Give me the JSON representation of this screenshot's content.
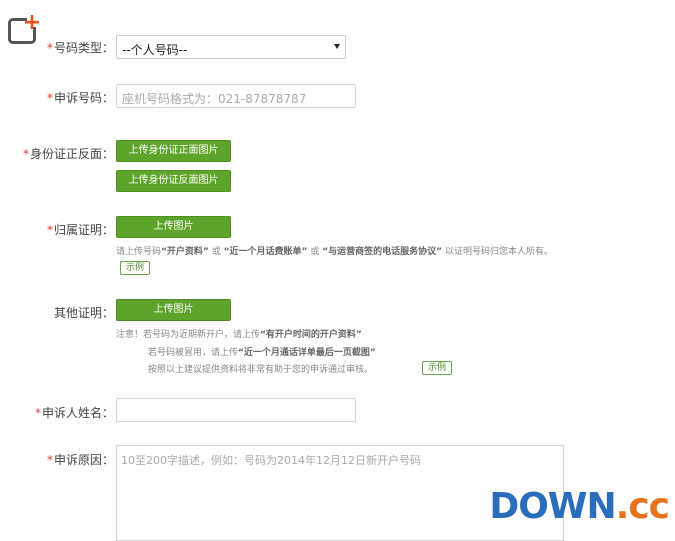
{
  "form": {
    "number_type": {
      "label": "号码类型：",
      "value": "--个人号码--"
    },
    "appeal_number": {
      "label": "申诉号码：",
      "placeholder": "座机号码格式为：021-87878787"
    },
    "id_card": {
      "label": "身份证正反面：",
      "upload_front": "上传身份证正面图片",
      "upload_back": "上传身份证反面图片"
    },
    "ownership": {
      "label": "归属证明：",
      "upload": "上传图片",
      "hint_prefix": "请上传号码",
      "hint_item1": "“开户资料”",
      "hint_or1": "或",
      "hint_item2": "“近一个月话费账单”",
      "hint_or2": "或",
      "hint_item3": "“与运营商签的电话服务协议”",
      "hint_suffix": "以证明号码归您本人所有。",
      "example": "示例"
    },
    "other": {
      "label": "其他证明：",
      "upload": "上传图片",
      "note1_prefix": "注意！若号码为近期新开户，请上传",
      "note1_item": "“有开户时间的开户资料”",
      "note2_prefix": "若号码被冒用，请上传",
      "note2_item": "“近一个月通话详单最后一页截图”",
      "note3": "按照以上建议提供资料将非常有助于您的申诉通过审核。",
      "example": "示例"
    },
    "appellant_name": {
      "label": "申诉人姓名："
    },
    "reason": {
      "label": "申诉原因：",
      "placeholder": "10至200字描述，例如：号码为2014年12月12日新开户号码"
    }
  },
  "watermark": {
    "main": "DOWN",
    "suffix": ".cc"
  },
  "colors": {
    "accent_green": "#5ea32a",
    "required_star": "#e4393c"
  }
}
